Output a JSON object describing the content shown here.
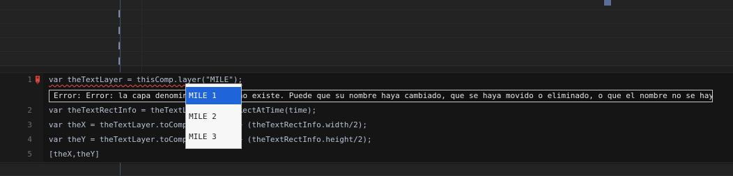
{
  "editor": {
    "lines": [
      {
        "number": "1",
        "code": "var theTextLayer = thisComp.layer(\"MILE\");"
      },
      {
        "number": "2",
        "code": "var theTextRectInfo = theTextLayer.sourceRectAtTime(time);"
      },
      {
        "number": "3",
        "code": "var theX = theTextLayer.toComp([0,0])[0] + (theTextRectInfo.width/2);"
      },
      {
        "number": "4",
        "code": "var theY = theTextLayer.toComp([0,0])[1] + (theTextRectInfo.height/2);"
      },
      {
        "number": "5",
        "code": "[theX,theY]"
      }
    ],
    "error_tooltip": "Error: Error: la capa denominada 'MILE' no existe. Puede que su nombre haya cambiado, que se haya movido o eliminado, o que el nombre no se haya escrito bien",
    "error_icon": "error-marker-icon"
  },
  "autocomplete": {
    "items": [
      "MILE 1",
      "MILE 2",
      "MILE 3"
    ],
    "selected": "MILE 1"
  },
  "colors": {
    "selection": "#1f65d9",
    "error": "#d24b3c"
  }
}
